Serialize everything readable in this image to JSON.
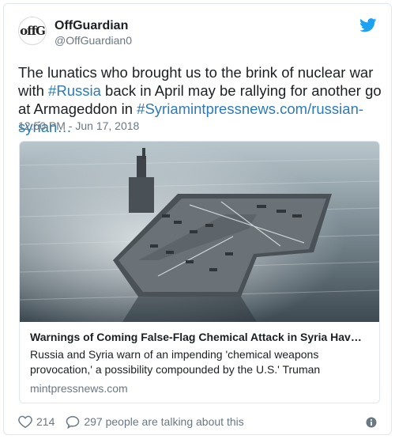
{
  "author": {
    "display_name": "OffGuardian",
    "handle": "@OffGuardian0",
    "avatar_text": "offG"
  },
  "tweet": {
    "text_1": "The lunatics who brought us to the brink of nuclear war with ",
    "hashtag_1": "#Russia",
    "text_2": " back in April may be rallying for another go at Armageddon in ",
    "hashtag_2": "#Syria",
    "link": "mintpressnews.com/russian-syrian…",
    "timestamp": "12:50 PM - Jun 17, 2018"
  },
  "card": {
    "image_alt": "aircraft carrier at sea",
    "title": "Warnings of Coming False-Flag Chemical Attack in Syria Hav…",
    "description": "Russia and Syria warn of an impending 'chemical weapons provocation,' a possibility compounded by the U.S.' Truman",
    "domain": "mintpressnews.com"
  },
  "actions": {
    "likes": "214",
    "replies_text": "297 people are talking about this"
  },
  "colors": {
    "link": "#2b7bb9",
    "twitter_blue": "#1da1f2",
    "muted": "#697882"
  },
  "icons": [
    "twitter-bird-icon",
    "heart-icon",
    "reply-bubble-icon",
    "info-icon"
  ]
}
